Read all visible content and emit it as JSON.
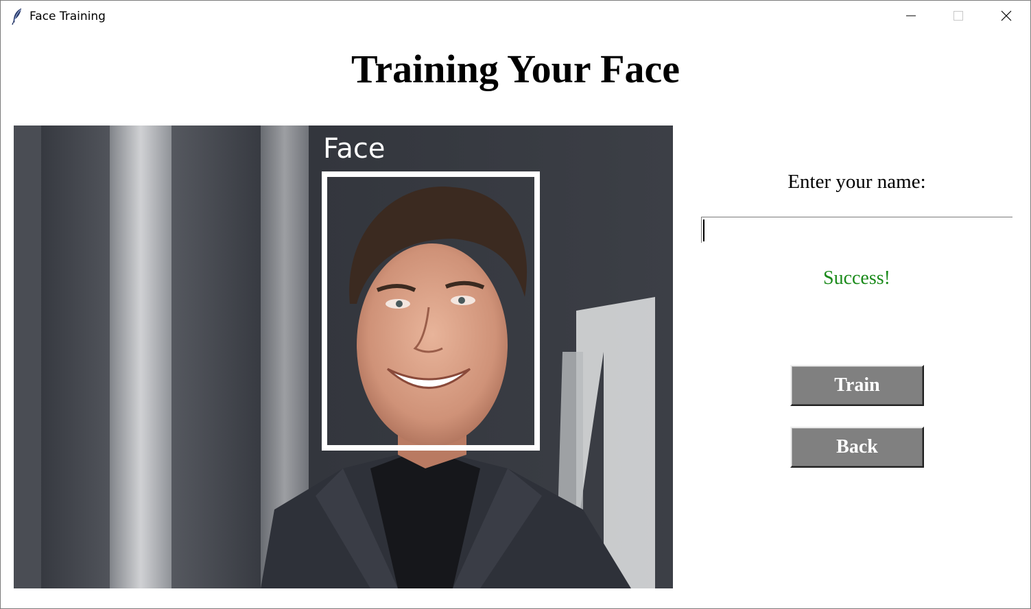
{
  "window": {
    "title": "Face Training",
    "app_icon": "feather-icon",
    "controls": {
      "minimize": "minimize-icon",
      "maximize": "maximize-icon",
      "close": "close-icon"
    }
  },
  "header": {
    "title": "Training Your Face"
  },
  "photo": {
    "overlay_label": "Face",
    "box_color": "#ffffff"
  },
  "form": {
    "name_label": "Enter your name:",
    "name_value": "",
    "status_text": "Success!",
    "status_color": "#1a8a1a"
  },
  "buttons": {
    "train_label": "Train",
    "back_label": "Back",
    "button_bg": "#808080",
    "button_text_color": "#ffffff"
  }
}
